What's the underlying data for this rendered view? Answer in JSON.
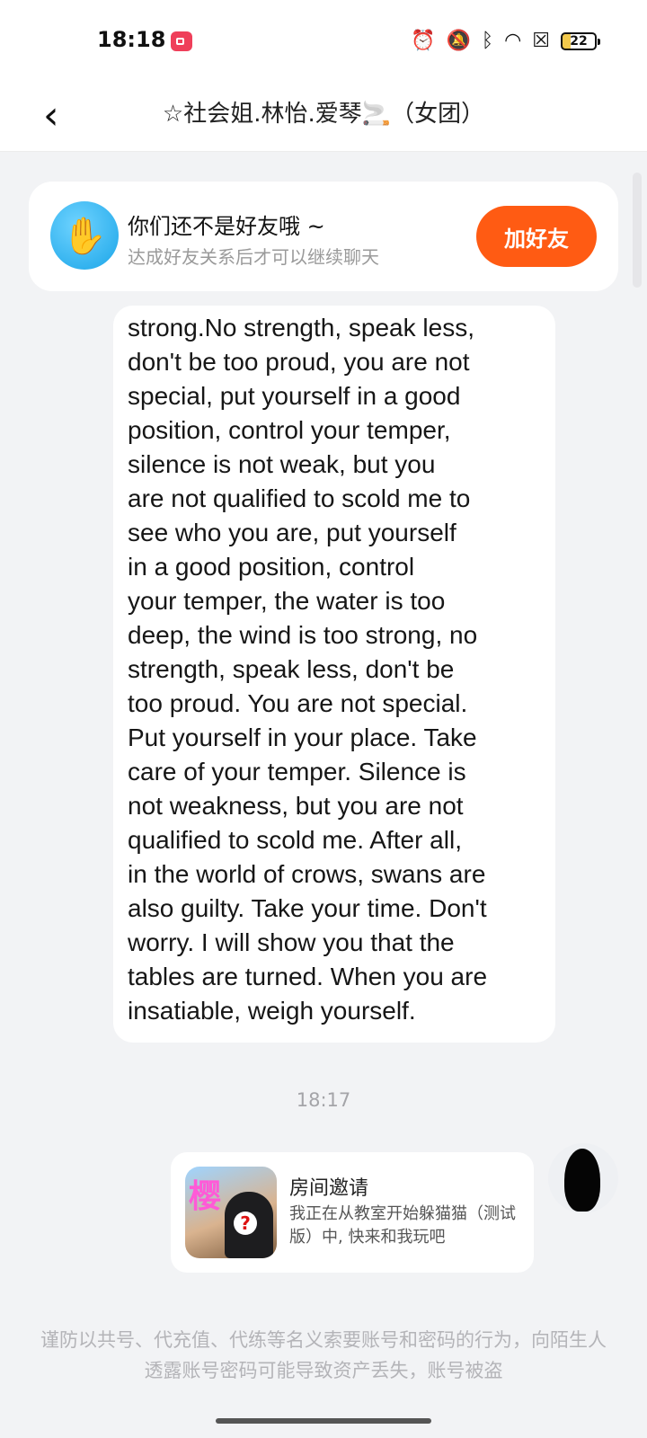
{
  "status_bar": {
    "time": "18:18",
    "battery": "22",
    "icons": [
      "screen-record-icon",
      "alarm-icon",
      "mute-icon",
      "bluetooth-icon",
      "wifi-icon",
      "no-sim-icon",
      "battery-icon"
    ]
  },
  "header": {
    "title": "☆社会姐.林怡.爱琴🚬（女团）",
    "back_icon": "chevron-left-icon"
  },
  "friend_banner": {
    "title": "你们还不是好友哦 ~",
    "subtitle": "达成好友关系后才可以继续聊天",
    "button": "加好友",
    "button_color": "#ff5b13"
  },
  "message": {
    "text": "strong.No strength, speak less,\ndon't be too proud, you are not\nspecial, put yourself in a good\nposition, control your temper,\nsilence is not weak, but you\nare not qualified to scold me to\nsee who you are, put yourself\nin a good position, control\nyour temper, the water is too\ndeep, the wind is too strong, no\nstrength, speak less, don't be\ntoo proud. You are not special.\nPut yourself in your place. Take\ncare of your temper. Silence is\nnot weakness, but you are not\nqualified to scold me. After all,\nin the world of crows, swans are\nalso guilty. Take your time. Don't\nworry. I will show you that the\ntables are turned. When you are\ninsatiable, weigh yourself."
  },
  "timestamp": "18:17",
  "invite_card": {
    "title": "房间邀请",
    "description": "我正在从教室开始躲猫猫（测试版）中, 快来和我玩吧",
    "icon_text": "樱"
  },
  "notice": "谨防以共号、代充值、代练等名义索要账号和密码的行为，向陌生人透露账号密码可能导致资产丢失，账号被盗"
}
